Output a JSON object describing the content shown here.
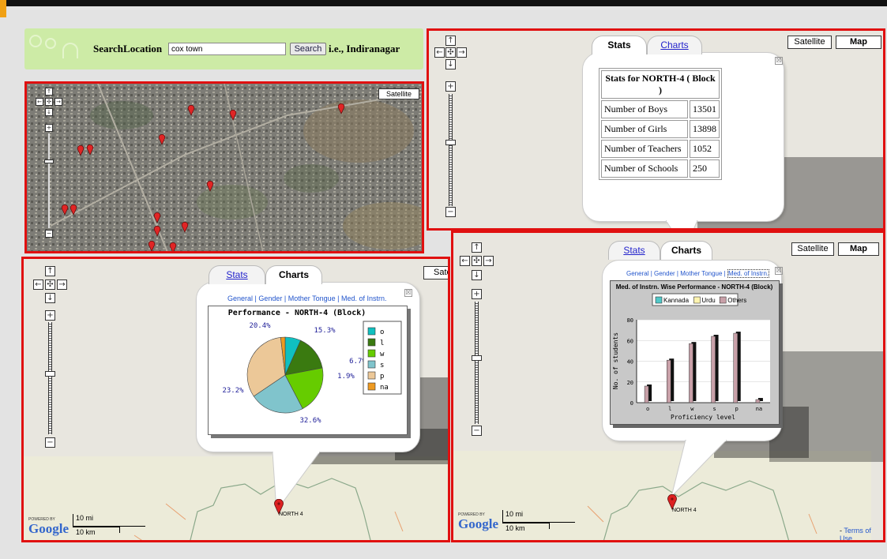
{
  "search": {
    "label": "SearchLocation",
    "value": "cox town",
    "button": "Search",
    "hint": "i.e., Indiranagar"
  },
  "satellite_map": {
    "satellite_label": "Satellite"
  },
  "map_types": {
    "satellite": "Satellite",
    "map": "Map",
    "satellite_partial": "Sate"
  },
  "controls": {
    "up": "↑",
    "down": "↓",
    "left": "←",
    "right": "→",
    "center": "✣",
    "zoom_in": "+",
    "zoom_out": "−"
  },
  "tabs": {
    "stats": "Stats",
    "charts": "Charts"
  },
  "close": "☒",
  "stats": {
    "title": "Stats for NORTH-4 ( Block )",
    "rows": [
      {
        "label": "Number of Boys",
        "value": "13501"
      },
      {
        "label": "Number of Girls",
        "value": "13898"
      },
      {
        "label": "Number of Teachers",
        "value": "1052"
      },
      {
        "label": "Number of Schools",
        "value": "250"
      }
    ]
  },
  "chart_links": {
    "l1": "General",
    "sep": " | ",
    "l2": "Gender",
    "l3": "Mother Tongue",
    "l4": "Med. of Instrn."
  },
  "marker_label": "NORTH 4",
  "footer": {
    "powered": "POWERED BY",
    "google": "Google",
    "scale_mi": "10 mi",
    "scale_km": "10 km",
    "terms_prefix": "- ",
    "terms": "Terms of Use"
  },
  "chart_data": [
    {
      "type": "pie",
      "title": "Performance - NORTH-4 (Block)",
      "categories": [
        "o",
        "l",
        "w",
        "s",
        "p",
        "na"
      ],
      "values": [
        6.7,
        15.3,
        20.4,
        23.2,
        32.6,
        1.9
      ],
      "labels": [
        "6.7%",
        "15.3%",
        "20.4%",
        "23.2%",
        "32.6%",
        "1.9%"
      ],
      "colors": [
        "#10c0c0",
        "#3a7a10",
        "#66cc00",
        "#80c4cc",
        "#ecc898",
        "#ee9a20"
      ],
      "legend": "right"
    },
    {
      "type": "bar",
      "title": "Med. of Instrn. Wise Performance - NORTH-4 (Block)",
      "categories": [
        "o",
        "l",
        "w",
        "s",
        "p",
        "na"
      ],
      "series": [
        {
          "name": "Kannada",
          "values": [
            0,
            0,
            0,
            0,
            0,
            0
          ],
          "color": "#50c8c8"
        },
        {
          "name": "Urdu",
          "values": [
            0,
            0,
            0,
            0,
            0,
            0
          ],
          "color": "#fff4b0"
        },
        {
          "name": "Others",
          "values": [
            16,
            41,
            57,
            64,
            67,
            3
          ],
          "color": "#c8a0a8"
        }
      ],
      "xlabel": "Proficiency level",
      "ylabel": "No. of students",
      "ylim": [
        0,
        80
      ],
      "yticks": [
        0,
        20,
        40,
        60,
        80
      ],
      "legend": "top"
    }
  ]
}
